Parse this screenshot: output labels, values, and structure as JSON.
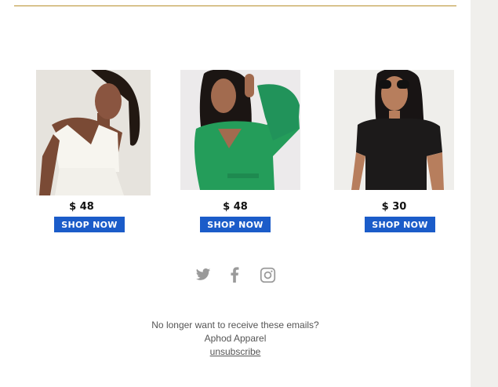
{
  "products": [
    {
      "price": "$ 48",
      "button_label": "SHOP NOW",
      "image": "model-white-strapless-top"
    },
    {
      "price": "$ 48",
      "button_label": "SHOP NOW",
      "image": "model-green-wrap-top"
    },
    {
      "price": "$ 30",
      "button_label": "SHOP NOW",
      "image": "model-black-tee-sunglasses"
    }
  ],
  "social_icons": [
    "twitter-icon",
    "facebook-icon",
    "instagram-icon"
  ],
  "footer": {
    "line1": "No longer want to receive these emails?",
    "company": "Aphod Apparel",
    "unsubscribe": "unsubscribe"
  },
  "colors": {
    "accent_rule": "#b8902e",
    "button": "#1b5cc9",
    "icon_gray": "#9a9a9a",
    "gutter": "#f0efec"
  }
}
